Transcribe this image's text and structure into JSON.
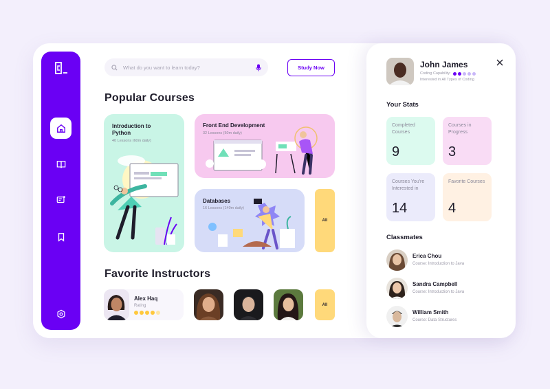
{
  "search": {
    "placeholder": "What do you want to learn today?",
    "icon": "search-icon",
    "mic_icon": "microphone-icon"
  },
  "header": {
    "study_now_label": "Study Now"
  },
  "sidebar": {
    "logo": "C_",
    "items": [
      {
        "name": "home",
        "icon": "home-icon",
        "active": true
      },
      {
        "name": "courses",
        "icon": "book-icon",
        "active": false
      },
      {
        "name": "messages",
        "icon": "chat-icon",
        "active": false
      },
      {
        "name": "saved",
        "icon": "bookmark-icon",
        "active": false
      }
    ],
    "settings_icon": "settings-icon"
  },
  "popular": {
    "title": "Popular Courses",
    "courses": [
      {
        "title": "Introduction to Python",
        "lessons": "40 Lessons (60m daily)",
        "color": "#c9f5e6"
      },
      {
        "title": "Front End Development",
        "lessons": "32 Lessons (50m daily)",
        "color": "#f7c9ef"
      },
      {
        "title": "Databases",
        "lessons": "16 Lessons (140m daily)",
        "color": "#d6dcf8"
      }
    ],
    "all_label": "All"
  },
  "instructors": {
    "title": "Favorite Instructors",
    "featured": {
      "name": "Alex Haq",
      "rating_label": "Rating",
      "rating": 4,
      "max_rating": 5
    },
    "all_label": "All"
  },
  "profile": {
    "name": "John James",
    "capability_label": "Coding Capability:",
    "capability_level": 2,
    "capability_max": 5,
    "interest": "Interested in All Types of Coding"
  },
  "stats": {
    "title": "Your Stats",
    "items": [
      {
        "label": "Completed Courses",
        "value": "9",
        "color": "#dcfaef"
      },
      {
        "label": "Courses in Progress",
        "value": "3",
        "color": "#f9dcf5"
      },
      {
        "label": "Courses You're Interested in",
        "value": "14",
        "color": "#ebebfb"
      },
      {
        "label": "Favorite Courses",
        "value": "4",
        "color": "#fff1e3"
      }
    ]
  },
  "classmates": {
    "title": "Classmates",
    "items": [
      {
        "name": "Erica Chou",
        "course": "Course: Introduction to Java"
      },
      {
        "name": "Sandra Campbell",
        "course": "Course: Introduction to Java"
      },
      {
        "name": "William Smith",
        "course": "Course: Data Structures"
      }
    ]
  },
  "colors": {
    "accent": "#6a00f4",
    "background": "#f3effc",
    "yellow": "#ffd97a"
  }
}
